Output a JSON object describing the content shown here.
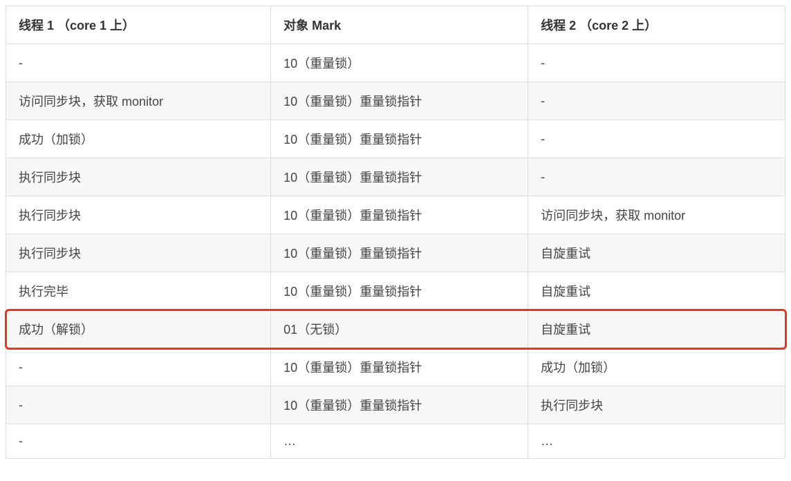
{
  "table": {
    "headers": {
      "col1": "线程 1 （core 1 上）",
      "col2": "对象 Mark",
      "col3": "线程 2 （core 2 上）"
    },
    "rows": [
      {
        "c1": "-",
        "c2": "10（重量锁）",
        "c3": "-"
      },
      {
        "c1": "访问同步块，获取 monitor",
        "c2": "10（重量锁）重量锁指针",
        "c3": "-"
      },
      {
        "c1": "成功（加锁）",
        "c2": "10（重量锁）重量锁指针",
        "c3": "-"
      },
      {
        "c1": "执行同步块",
        "c2": "10（重量锁）重量锁指针",
        "c3": "-"
      },
      {
        "c1": "执行同步块",
        "c2": "10（重量锁）重量锁指针",
        "c3": "访问同步块，获取 monitor"
      },
      {
        "c1": "执行同步块",
        "c2": "10（重量锁）重量锁指针",
        "c3": "自旋重试"
      },
      {
        "c1": "执行完毕",
        "c2": "10（重量锁）重量锁指针",
        "c3": "自旋重试"
      },
      {
        "c1": "成功（解锁）",
        "c2": "01（无锁）",
        "c3": "自旋重试"
      },
      {
        "c1": "-",
        "c2": "10（重量锁）重量锁指针",
        "c3": "成功（加锁）"
      },
      {
        "c1": "-",
        "c2": "10（重量锁）重量锁指针",
        "c3": "执行同步块"
      },
      {
        "c1": "-",
        "c2": "…",
        "c3": "…"
      }
    ],
    "highlighted_row_index": 7
  }
}
